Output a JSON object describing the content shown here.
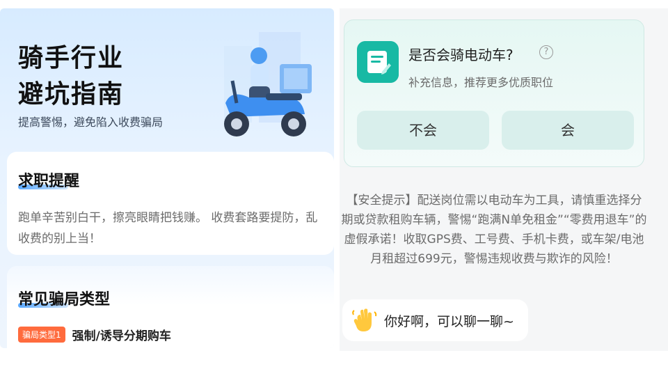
{
  "left": {
    "hero": {
      "title_line1": "骑手行业",
      "title_line2": "避坑指南",
      "subtitle": "提高警惕，避免陷入收费骗局"
    },
    "remind_card": {
      "title": "求职提醒",
      "text": "跑单辛苦别白干，擦亮眼睛把钱赚。 收费套路要提防，乱收费的别上当！"
    },
    "types_card": {
      "title": "常见骗局类型",
      "tag": "骗局类型1",
      "item": "强制/诱导分期购车"
    }
  },
  "right": {
    "question": {
      "title": "是否会骑电动车?",
      "help_symbol": "?",
      "subtitle": "补充信息，推荐更多优质职位",
      "options": [
        "不会",
        "会"
      ]
    },
    "safety_tip": "【安全提示】配送岗位需以电动车为工具，请慎重选择分期或贷款租购车辆，警惕“跑满N单免租金”“零费用退车”的虚假承诺！收取GPS费、工号费、手机卡费，或车架/电池月租超过699元，警惕违规收费与欺诈的风险！",
    "greeting": "你好啊，可以聊一聊~"
  },
  "colors": {
    "accent_teal": "#1bb8a4",
    "tag_orange": "#ff6b3d",
    "hero_blue": "#d7ebff"
  },
  "icons": [
    "scooter-rider-illustration",
    "document-app-icon",
    "help-icon",
    "waving-hand-icon"
  ]
}
